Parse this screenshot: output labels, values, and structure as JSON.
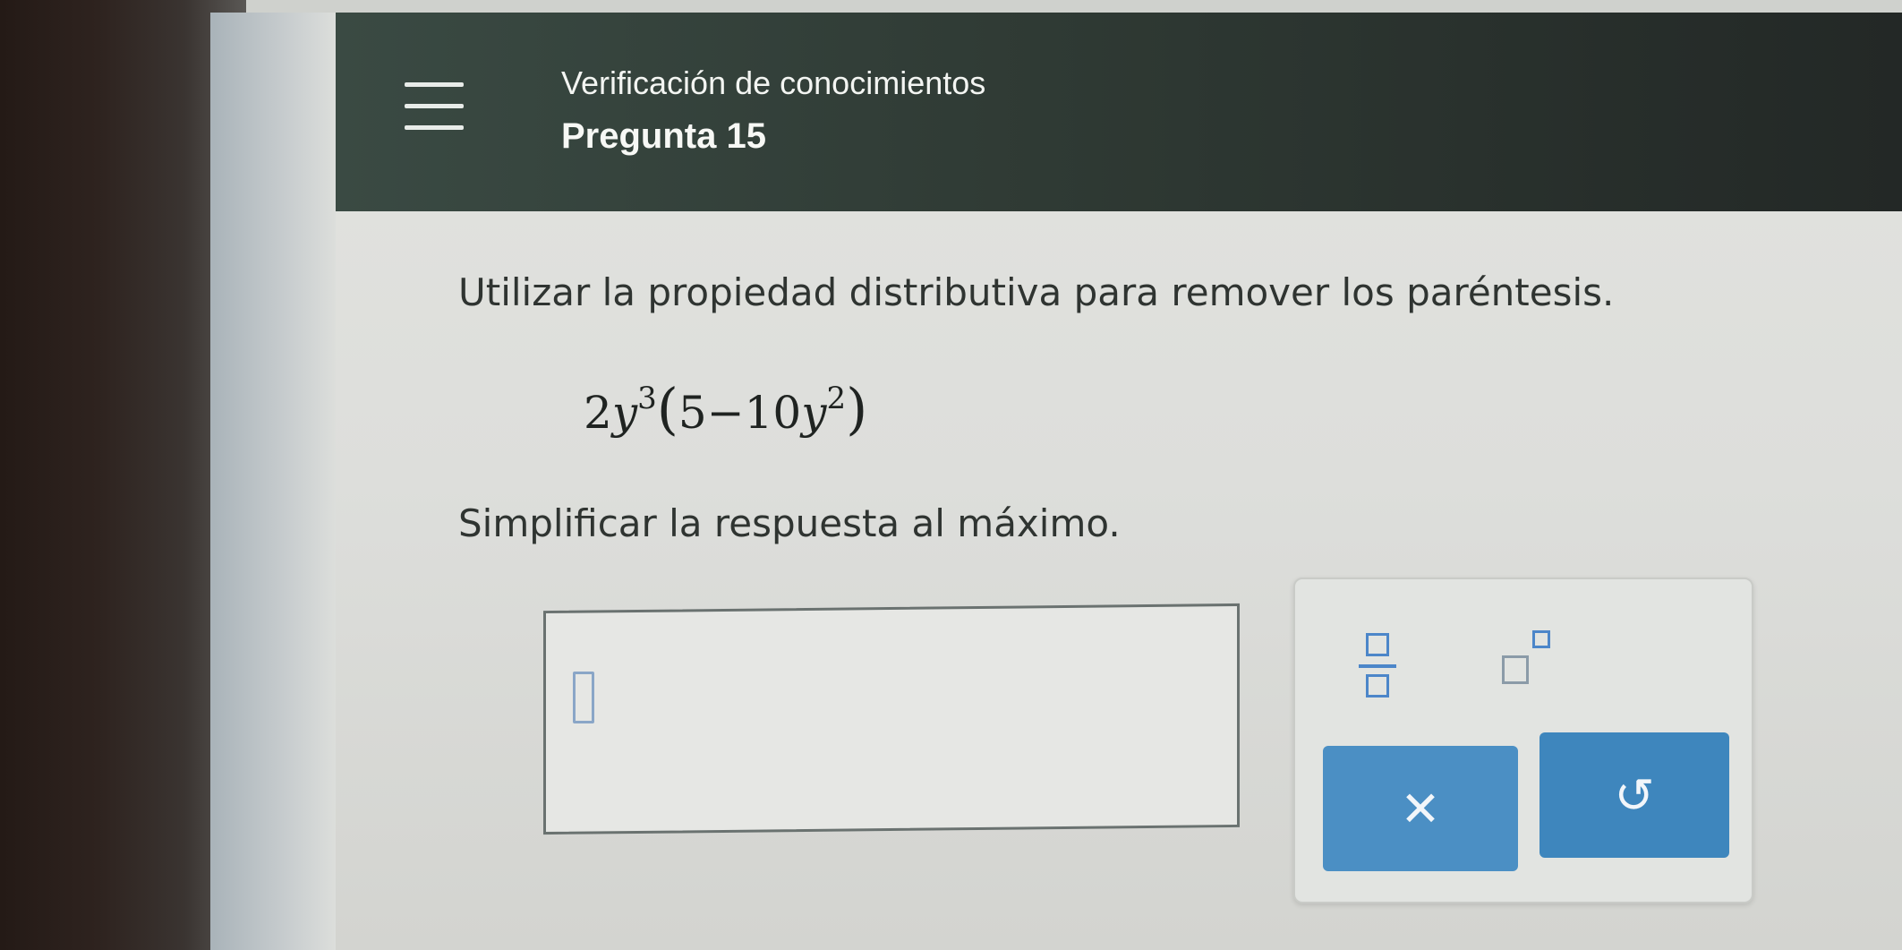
{
  "header": {
    "title": "Verificación de conocimientos",
    "subtitle": "Pregunta 15"
  },
  "question": {
    "instruction": "Utilizar la propiedad distributiva para remover los paréntesis.",
    "expression": {
      "coef": "2",
      "var1": "y",
      "exp1": "3",
      "open_paren": "(",
      "const": "5",
      "minus": "−",
      "coef2": "10",
      "var2": "y",
      "exp2": "2",
      "close_paren": ")"
    },
    "simplify_note": "Simplificar la respuesta al máximo."
  },
  "answer": {
    "value": ""
  },
  "tools": {
    "fraction_icon": "fraction-icon",
    "power_icon": "exponent-icon",
    "clear_glyph": "✕",
    "undo_glyph": "↺"
  },
  "colors": {
    "header_bg": "#2f3a34",
    "accent_blue": "#4b8fc4"
  }
}
